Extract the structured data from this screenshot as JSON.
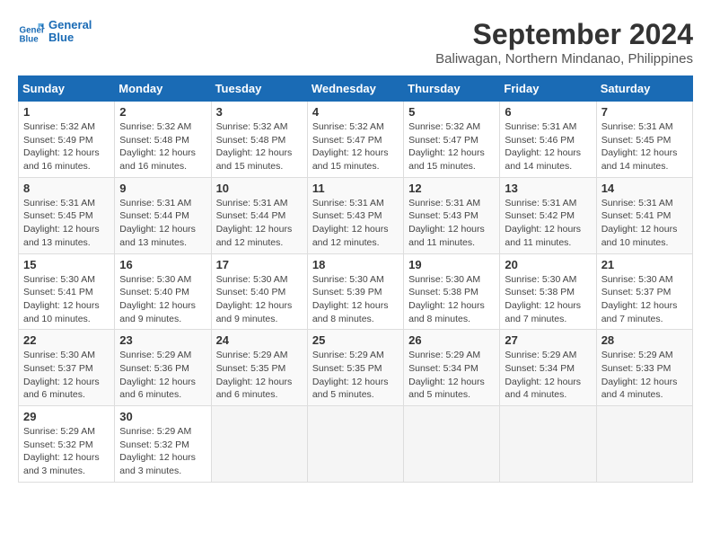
{
  "header": {
    "logo_line1": "General",
    "logo_line2": "Blue",
    "month_title": "September 2024",
    "location": "Baliwagan, Northern Mindanao, Philippines"
  },
  "calendar": {
    "days_of_week": [
      "Sunday",
      "Monday",
      "Tuesday",
      "Wednesday",
      "Thursday",
      "Friday",
      "Saturday"
    ],
    "weeks": [
      [
        null,
        null,
        null,
        null,
        null,
        null,
        null
      ]
    ],
    "cells": [
      {
        "day": "1",
        "col": 0,
        "info": "Sunrise: 5:32 AM\nSunset: 5:49 PM\nDaylight: 12 hours\nand 16 minutes."
      },
      {
        "day": "2",
        "col": 1,
        "info": "Sunrise: 5:32 AM\nSunset: 5:48 PM\nDaylight: 12 hours\nand 16 minutes."
      },
      {
        "day": "3",
        "col": 2,
        "info": "Sunrise: 5:32 AM\nSunset: 5:48 PM\nDaylight: 12 hours\nand 15 minutes."
      },
      {
        "day": "4",
        "col": 3,
        "info": "Sunrise: 5:32 AM\nSunset: 5:47 PM\nDaylight: 12 hours\nand 15 minutes."
      },
      {
        "day": "5",
        "col": 4,
        "info": "Sunrise: 5:32 AM\nSunset: 5:47 PM\nDaylight: 12 hours\nand 15 minutes."
      },
      {
        "day": "6",
        "col": 5,
        "info": "Sunrise: 5:31 AM\nSunset: 5:46 PM\nDaylight: 12 hours\nand 14 minutes."
      },
      {
        "day": "7",
        "col": 6,
        "info": "Sunrise: 5:31 AM\nSunset: 5:45 PM\nDaylight: 12 hours\nand 14 minutes."
      },
      {
        "day": "8",
        "col": 0,
        "info": "Sunrise: 5:31 AM\nSunset: 5:45 PM\nDaylight: 12 hours\nand 13 minutes."
      },
      {
        "day": "9",
        "col": 1,
        "info": "Sunrise: 5:31 AM\nSunset: 5:44 PM\nDaylight: 12 hours\nand 13 minutes."
      },
      {
        "day": "10",
        "col": 2,
        "info": "Sunrise: 5:31 AM\nSunset: 5:44 PM\nDaylight: 12 hours\nand 12 minutes."
      },
      {
        "day": "11",
        "col": 3,
        "info": "Sunrise: 5:31 AM\nSunset: 5:43 PM\nDaylight: 12 hours\nand 12 minutes."
      },
      {
        "day": "12",
        "col": 4,
        "info": "Sunrise: 5:31 AM\nSunset: 5:43 PM\nDaylight: 12 hours\nand 11 minutes."
      },
      {
        "day": "13",
        "col": 5,
        "info": "Sunrise: 5:31 AM\nSunset: 5:42 PM\nDaylight: 12 hours\nand 11 minutes."
      },
      {
        "day": "14",
        "col": 6,
        "info": "Sunrise: 5:31 AM\nSunset: 5:41 PM\nDaylight: 12 hours\nand 10 minutes."
      },
      {
        "day": "15",
        "col": 0,
        "info": "Sunrise: 5:30 AM\nSunset: 5:41 PM\nDaylight: 12 hours\nand 10 minutes."
      },
      {
        "day": "16",
        "col": 1,
        "info": "Sunrise: 5:30 AM\nSunset: 5:40 PM\nDaylight: 12 hours\nand 9 minutes."
      },
      {
        "day": "17",
        "col": 2,
        "info": "Sunrise: 5:30 AM\nSunset: 5:40 PM\nDaylight: 12 hours\nand 9 minutes."
      },
      {
        "day": "18",
        "col": 3,
        "info": "Sunrise: 5:30 AM\nSunset: 5:39 PM\nDaylight: 12 hours\nand 8 minutes."
      },
      {
        "day": "19",
        "col": 4,
        "info": "Sunrise: 5:30 AM\nSunset: 5:38 PM\nDaylight: 12 hours\nand 8 minutes."
      },
      {
        "day": "20",
        "col": 5,
        "info": "Sunrise: 5:30 AM\nSunset: 5:38 PM\nDaylight: 12 hours\nand 7 minutes."
      },
      {
        "day": "21",
        "col": 6,
        "info": "Sunrise: 5:30 AM\nSunset: 5:37 PM\nDaylight: 12 hours\nand 7 minutes."
      },
      {
        "day": "22",
        "col": 0,
        "info": "Sunrise: 5:30 AM\nSunset: 5:37 PM\nDaylight: 12 hours\nand 6 minutes."
      },
      {
        "day": "23",
        "col": 1,
        "info": "Sunrise: 5:29 AM\nSunset: 5:36 PM\nDaylight: 12 hours\nand 6 minutes."
      },
      {
        "day": "24",
        "col": 2,
        "info": "Sunrise: 5:29 AM\nSunset: 5:35 PM\nDaylight: 12 hours\nand 6 minutes."
      },
      {
        "day": "25",
        "col": 3,
        "info": "Sunrise: 5:29 AM\nSunset: 5:35 PM\nDaylight: 12 hours\nand 5 minutes."
      },
      {
        "day": "26",
        "col": 4,
        "info": "Sunrise: 5:29 AM\nSunset: 5:34 PM\nDaylight: 12 hours\nand 5 minutes."
      },
      {
        "day": "27",
        "col": 5,
        "info": "Sunrise: 5:29 AM\nSunset: 5:34 PM\nDaylight: 12 hours\nand 4 minutes."
      },
      {
        "day": "28",
        "col": 6,
        "info": "Sunrise: 5:29 AM\nSunset: 5:33 PM\nDaylight: 12 hours\nand 4 minutes."
      },
      {
        "day": "29",
        "col": 0,
        "info": "Sunrise: 5:29 AM\nSunset: 5:32 PM\nDaylight: 12 hours\nand 3 minutes."
      },
      {
        "day": "30",
        "col": 1,
        "info": "Sunrise: 5:29 AM\nSunset: 5:32 PM\nDaylight: 12 hours\nand 3 minutes."
      }
    ]
  }
}
